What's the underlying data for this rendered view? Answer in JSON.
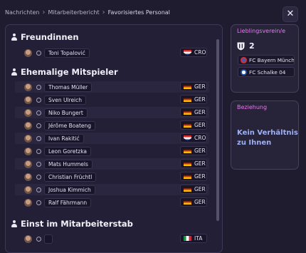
{
  "breadcrumb": [
    "Nachrichten",
    "Mitarbeiterbericht",
    "Favorisiertes Personal"
  ],
  "close_label": "✕",
  "sections": {
    "friends": {
      "title": "Freundinnen",
      "rows": [
        {
          "name": "Toni Topalović",
          "nationality": "CRO"
        }
      ]
    },
    "former_teammates": {
      "title": "Ehemalige Mitspieler",
      "rows": [
        {
          "name": "Thomas Müller",
          "nationality": "GER"
        },
        {
          "name": "Sven Ulreich",
          "nationality": "GER"
        },
        {
          "name": "Niko Bungert",
          "nationality": "GER"
        },
        {
          "name": "Jérôme Boateng",
          "nationality": "GER"
        },
        {
          "name": "Ivan Rakitić",
          "nationality": "CRO"
        },
        {
          "name": "Leon Goretzka",
          "nationality": "GER"
        },
        {
          "name": "Mats Hummels",
          "nationality": "GER"
        },
        {
          "name": "Christian Früchtl",
          "nationality": "GER"
        },
        {
          "name": "Joshua Kimmich",
          "nationality": "GER"
        },
        {
          "name": "Ralf Fährmann",
          "nationality": "GER"
        }
      ]
    },
    "staff": {
      "title": "Einst im Mitarbeiterstab",
      "rows": [
        {
          "name": "",
          "nationality": "ITA"
        }
      ]
    }
  },
  "favorite_club": {
    "title": "Lieblingsverein/e",
    "count": "2",
    "clubs": [
      "FC Bayern Münche",
      "FC Schalke 04"
    ]
  },
  "relationship": {
    "title": "Beziehung",
    "text_line1": "Kein Verhältnis",
    "text_line2": "zu Ihnen"
  }
}
